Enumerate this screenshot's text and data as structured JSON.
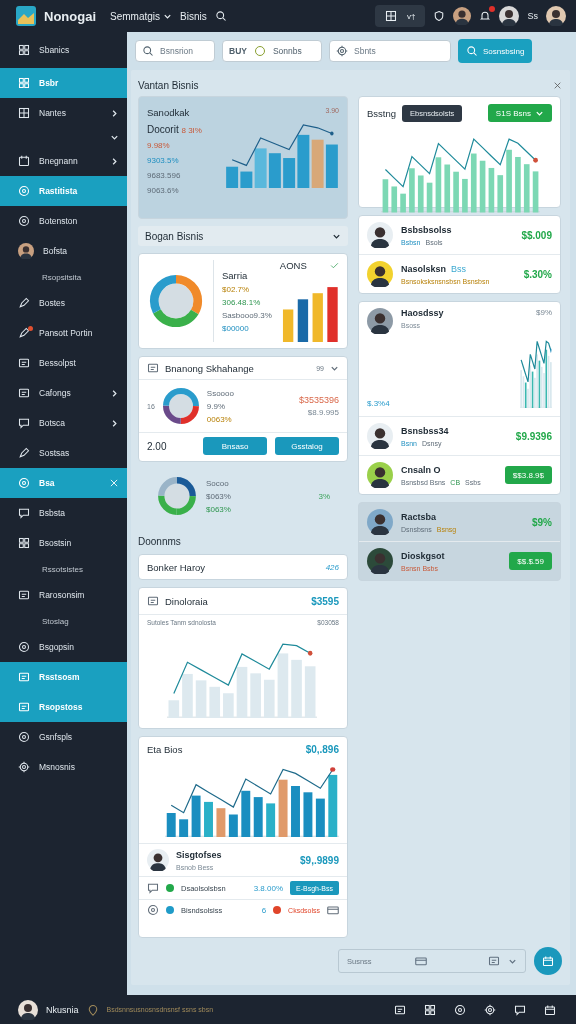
{
  "app": {
    "name": "Nonogai",
    "menu": [
      {
        "label": "Semmatgis",
        "dropdown": true
      },
      {
        "label": "Bisnis",
        "dropdown": false
      }
    ],
    "toggle": "v†",
    "user": "Ss",
    "notification_badge": true
  },
  "sidebar": {
    "top_item": "Sbanics",
    "items": [
      {
        "label": "Bsbr",
        "kind": "item",
        "selected": true
      },
      {
        "label": "Nantes",
        "kind": "item",
        "selected": false,
        "expandable": true
      },
      {
        "kind": "expander",
        "selected": false,
        "expanded": true
      },
      {
        "label": "Bnegnann",
        "kind": "item",
        "selected": false,
        "expandable": true
      },
      {
        "label": "Rastitista",
        "kind": "item",
        "selected": true
      },
      {
        "label": "Botenston",
        "kind": "item",
        "selected": false
      },
      {
        "label": "Bofsta",
        "kind": "person",
        "selected": false
      },
      {
        "label": "Rsopsitsita",
        "kind": "sub",
        "selected": false
      },
      {
        "label": "Bostes",
        "kind": "item",
        "selected": false
      },
      {
        "label": "Pansott Portin",
        "kind": "item",
        "selected": false,
        "badge": true
      },
      {
        "label": "Bessolpst",
        "kind": "item",
        "selected": false
      },
      {
        "label": "Cafongs",
        "kind": "item",
        "selected": false,
        "expandable": true
      },
      {
        "label": "Botsca",
        "kind": "item",
        "selected": false,
        "expandable": true
      },
      {
        "label": "Sostsas",
        "kind": "item",
        "selected": false
      },
      {
        "label": "Bsa",
        "kind": "item",
        "selected": true,
        "closable": true
      },
      {
        "label": "Bsbsta",
        "kind": "item",
        "selected": false
      },
      {
        "label": "Bsostsin",
        "kind": "item",
        "selected": false
      },
      {
        "label": "Rssotsistes",
        "kind": "sub",
        "selected": false
      },
      {
        "label": "Rarosonsim",
        "kind": "item",
        "selected": false
      },
      {
        "label": "Stoslag",
        "kind": "sub",
        "selected": false
      },
      {
        "label": "Bsgopsin",
        "kind": "item",
        "selected": false
      },
      {
        "label": "Rsstsosm",
        "kind": "item",
        "selected": true
      },
      {
        "label": "Rsopstoss",
        "kind": "item",
        "selected": true
      },
      {
        "label": "Gsnfspls",
        "kind": "item",
        "selected": false
      },
      {
        "label": "Msnosnis",
        "kind": "item",
        "selected": false
      }
    ]
  },
  "toolbar": {
    "search": {
      "placeholder": "Bsnsrion"
    },
    "chip": {
      "code": "BUY",
      "label": "Sonnbs"
    },
    "filter": {
      "placeholder": "Sbnts"
    },
    "button": "Sosnsbsing"
  },
  "panel": {
    "title": "Vantan Bisnis",
    "stat_card": {
      "title": "Sanodkak",
      "corner": "3.90",
      "headline": "Docorit",
      "headline_delta": "8 3I%",
      "lines": [
        {
          "text": "9.98%",
          "kind": "negative"
        },
        {
          "text": "9303.5%",
          "kind": "info"
        },
        {
          "text": "9683.596",
          "kind": "muted"
        },
        {
          "text": "9063.6%",
          "kind": "muted"
        }
      ]
    },
    "section": {
      "title": "Bogan Bisnis",
      "expanded": true
    },
    "mix_card": {
      "title": "Sarria",
      "title_2": "AONS",
      "checked": true,
      "lines": [
        {
          "text": "$02.7%",
          "kind": "warning"
        },
        {
          "text": "306.48.1%",
          "kind": "positive"
        },
        {
          "text": "Sasbooo9.3%",
          "kind": "muted"
        },
        {
          "text": "$00000",
          "kind": "info"
        }
      ]
    },
    "exchange_card": {
      "title": "Bnanong Skhahange",
      "meta": "99",
      "axis": "16",
      "lines": [
        {
          "text": "Ssoooo",
          "kind": "muted"
        },
        {
          "text": "9.9%",
          "kind": "muted"
        },
        {
          "text": "0063%",
          "kind": "warning"
        }
      ],
      "amount": "$3535396",
      "amount_2": "$8.9.995",
      "total": "2.00",
      "buttons": [
        "Bnsaso",
        "Gsstalog"
      ]
    },
    "donut_summary": {
      "lines": [
        {
          "text": "Socoo",
          "kind": "muted"
        },
        {
          "text": "$063%",
          "kind": "muted"
        },
        {
          "text": "$063%",
          "kind": "positive"
        }
      ],
      "value": "3%"
    },
    "docs_title": "Doonnms",
    "history": {
      "title": "Bonker Haroy",
      "value": "426"
    },
    "trend_card": {
      "title": "Dinoloraia",
      "value": "$3595",
      "subtitle": "Sutoles Tanm sdnolosta",
      "subvalue": "$03058"
    },
    "bios_card": {
      "title": "Eta Bios",
      "value": "$0,.896",
      "person": {
        "name": "Sisgtofses",
        "sub": "Bsnob Bess",
        "value": "$9,.9899"
      },
      "rows": [
        {
          "kind": "action",
          "color": "#22a84a",
          "label": "Dsaolsolsbsn",
          "value": "3.8.00%",
          "button": "E-Bsgh-Bss"
        },
        {
          "kind": "status",
          "color": "#1f9bc8",
          "label": "Bisndsolsiss",
          "value": "6",
          "status": {
            "text": "Cksdsolss",
            "color": "#e0452a"
          }
        }
      ]
    },
    "right_chart": {
      "title": "Bsstng",
      "tag": "Ebsnsdsolsts",
      "dropdown": "S1S Bsns"
    },
    "people": [
      {
        "name": "Bsbsbsolss",
        "sub": [
          {
            "text": "Bsbsn",
            "kind": "info"
          },
          {
            "text": "Bsols",
            "kind": "muted"
          }
        ],
        "value": {
          "text": "$$.009",
          "kind": "text"
        }
      },
      {
        "name": "Nasolsksn",
        "tag": "Bss",
        "sub": [
          {
            "text": "Bsnsoksksnsnsbsn Bsnsbsn",
            "kind": "warning"
          }
        ],
        "value": {
          "text": "$.30%",
          "kind": "text"
        }
      }
    ],
    "trend_person": {
      "name": "Haosdssy",
      "sub": "Bsoss",
      "corner": "$9%",
      "side": "$.3%4"
    },
    "people_2": [
      {
        "name": "Bsnsbss34",
        "sub": [
          {
            "text": "Bsnn",
            "kind": "info"
          },
          {
            "text": "Dsnsy",
            "kind": "muted"
          }
        ],
        "value": {
          "text": "$9.9396",
          "kind": "text"
        }
      },
      {
        "name": "Cnsaln O",
        "sub": [
          {
            "text": "Bsnsbsd Bsns",
            "kind": "muted"
          },
          {
            "text": "CB",
            "kind": "positive"
          },
          {
            "text": "Ssbs",
            "kind": "muted"
          }
        ],
        "value": {
          "text": "$$3.8.9$",
          "kind": "button"
        }
      }
    ],
    "people_3": [
      {
        "name": "Ractsba",
        "sub": [
          {
            "text": "Dsnsbsns",
            "kind": "muted"
          },
          {
            "text": "Bsnsg",
            "kind": "warning"
          }
        ],
        "value": {
          "text": "$9%",
          "kind": "text"
        }
      },
      {
        "name": "Dioskgsot",
        "sub": [
          {
            "text": "Bsnsn Bsbs",
            "kind": "negative"
          }
        ],
        "value": {
          "text": "$$.$.59",
          "kind": "button"
        }
      }
    ]
  },
  "footer": {
    "filter": {
      "placeholder": "Susnss"
    }
  },
  "status_bar": {
    "user": "Nkusnia",
    "location": "Bsdsnnsusnosnsdnsnsf ssns sbsn"
  }
}
